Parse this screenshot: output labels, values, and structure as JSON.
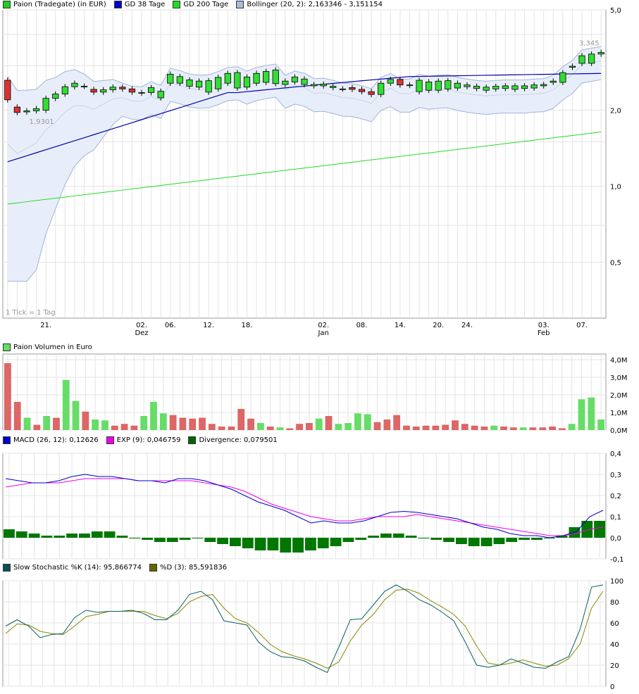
{
  "chart_data": [
    {
      "type": "candlestick",
      "title": "Paion (Tradegate) (in EUR)",
      "legend": [
        {
          "label": "Paion (Tradegate) (in EUR)",
          "color": "#22cc22"
        },
        {
          "label": "GD 38 Tage",
          "color": "#0000cc"
        },
        {
          "label": "GD 200 Tage",
          "color": "#22dd22"
        },
        {
          "label": "Bollinger (20, 2): 2,163346 - 3,151154",
          "color": "#a8bce0"
        }
      ],
      "y_scale": "log",
      "ylim": [
        0.3,
        5.0
      ],
      "y_ticks": [
        {
          "value": 5.0,
          "label": "5,0"
        },
        {
          "value": 2.0,
          "label": "2,0"
        },
        {
          "value": 1.0,
          "label": "1,0"
        },
        {
          "value": 0.5,
          "label": "0,5"
        }
      ],
      "x_ticks": [
        {
          "index": 2,
          "label": "21."
        },
        {
          "index": 7,
          "label": "02.",
          "sub": "Dez"
        },
        {
          "index": 9,
          "label": "06."
        },
        {
          "index": 11,
          "label": "12."
        },
        {
          "index": 13,
          "label": "18."
        },
        {
          "index": 17,
          "label": "02.",
          "sub": "Jan"
        },
        {
          "index": 19,
          "label": "08."
        },
        {
          "index": 21,
          "label": "14."
        },
        {
          "index": 23,
          "label": "20."
        },
        {
          "index": 25,
          "label": "24."
        },
        {
          "index": 29,
          "label": "03.",
          "sub": "Feb"
        },
        {
          "index": 31,
          "label": "07."
        }
      ],
      "annotations": [
        "1,9301",
        "3,345"
      ],
      "footnote": "1 Tick = 1 Tag",
      "open": [
        2.63,
        2.06,
        1.97,
        1.99,
        2.0,
        2.23,
        2.32,
        2.48,
        2.49,
        2.42,
        2.36,
        2.41,
        2.47,
        2.43,
        2.34,
        2.35,
        2.24,
        2.56,
        2.56,
        2.49,
        2.47,
        2.36,
        2.43,
        2.56,
        2.45,
        2.47,
        2.56,
        2.58,
        2.55,
        2.53,
        2.59,
        2.53,
        2.5,
        2.5,
        2.46,
        2.43,
        2.46,
        2.42,
        2.37,
        2.31,
        2.56,
        2.65,
        2.51,
        2.37,
        2.4,
        2.4,
        2.43,
        2.45,
        2.48,
        2.44,
        2.4,
        2.43,
        2.44,
        2.42,
        2.44,
        2.45,
        2.5,
        2.58,
        2.58,
        2.96,
        3.07,
        3.07,
        3.34
      ],
      "close": [
        2.2,
        1.96,
        1.99,
        2.03,
        2.23,
        2.32,
        2.48,
        2.56,
        2.49,
        2.36,
        2.41,
        2.47,
        2.43,
        2.36,
        2.35,
        2.46,
        2.38,
        2.78,
        2.72,
        2.64,
        2.61,
        2.62,
        2.7,
        2.8,
        2.82,
        2.71,
        2.8,
        2.85,
        2.89,
        2.61,
        2.71,
        2.66,
        2.53,
        2.54,
        2.49,
        2.43,
        2.42,
        2.37,
        2.31,
        2.56,
        2.65,
        2.52,
        2.52,
        2.63,
        2.59,
        2.61,
        2.62,
        2.56,
        2.52,
        2.49,
        2.47,
        2.49,
        2.5,
        2.5,
        2.5,
        2.52,
        2.53,
        2.61,
        2.82,
        2.99,
        3.29,
        3.34,
        3.39
      ],
      "volume_series": {
        "title": "Paion Volumen in Euro",
        "ylim": [
          0,
          4000000
        ],
        "y_ticks": [
          "0,0M",
          "1,0M",
          "2,0M",
          "3,0M",
          "4,0M"
        ],
        "values": [
          3800000,
          1600000,
          700000,
          300000,
          800000,
          700000,
          2850000,
          1650000,
          1050000,
          600000,
          550000,
          250000,
          350000,
          250000,
          800000,
          1600000,
          950000,
          850000,
          700000,
          650000,
          700000,
          350000,
          200000,
          200000,
          1200000,
          650000,
          400000,
          200000,
          150000,
          100000,
          350000,
          400000,
          650000,
          800000,
          350000,
          400000,
          950000,
          900000,
          450000,
          600000,
          850000,
          250000,
          200000,
          250000,
          250000,
          300000,
          550000,
          350000,
          250000,
          200000,
          250000,
          200000,
          150000,
          150000,
          150000,
          150000,
          200000,
          100000,
          350000,
          1750000,
          1850000,
          600000
        ],
        "up": [
          false,
          false,
          true,
          false,
          true,
          false,
          true,
          true,
          false,
          true,
          true,
          false,
          false,
          false,
          true,
          true,
          true,
          false,
          false,
          false,
          false,
          false,
          false,
          false,
          false,
          false,
          true,
          false,
          true,
          false,
          false,
          false,
          true,
          false,
          true,
          true,
          true,
          true,
          false,
          false,
          false,
          false,
          false,
          false,
          false,
          false,
          false,
          false,
          false,
          false,
          true,
          false,
          false,
          true,
          false,
          false,
          false,
          false,
          true,
          true,
          true,
          true
        ]
      }
    },
    {
      "type": "line",
      "legend": [
        {
          "label": "MACD (26, 12): 0,12626",
          "color": "#0000cc"
        },
        {
          "label": "EXP (9): 0,046759",
          "color": "#ee00ee"
        },
        {
          "label": "Divergence: 0,079501",
          "color": "#006600"
        }
      ],
      "ylim": [
        -0.1,
        0.4
      ],
      "y_ticks": [
        "0,4",
        "0,3",
        "0,2",
        "0,1",
        "0,0",
        "-0,1"
      ],
      "macd": [
        0.28,
        0.27,
        0.26,
        0.26,
        0.27,
        0.29,
        0.3,
        0.29,
        0.29,
        0.28,
        0.27,
        0.27,
        0.26,
        0.28,
        0.28,
        0.27,
        0.25,
        0.23,
        0.2,
        0.17,
        0.15,
        0.13,
        0.1,
        0.07,
        0.08,
        0.07,
        0.07,
        0.08,
        0.1,
        0.12,
        0.125,
        0.12,
        0.11,
        0.1,
        0.09,
        0.07,
        0.05,
        0.04,
        0.02,
        0.01,
        0.01,
        0.0,
        0.01,
        0.03,
        0.1,
        0.13
      ],
      "exp": [
        0.24,
        0.25,
        0.26,
        0.26,
        0.26,
        0.27,
        0.28,
        0.28,
        0.28,
        0.28,
        0.27,
        0.27,
        0.27,
        0.27,
        0.27,
        0.26,
        0.25,
        0.24,
        0.22,
        0.19,
        0.16,
        0.14,
        0.12,
        0.1,
        0.09,
        0.08,
        0.08,
        0.09,
        0.1,
        0.1,
        0.1,
        0.11,
        0.1,
        0.09,
        0.08,
        0.07,
        0.06,
        0.05,
        0.04,
        0.03,
        0.02,
        0.01,
        0.01,
        0.02,
        0.04,
        0.05
      ],
      "divergence": [
        0.04,
        0.03,
        0.02,
        0.01,
        0.01,
        0.02,
        0.02,
        0.03,
        0.03,
        0.01,
        0.0,
        -0.01,
        -0.02,
        -0.02,
        -0.01,
        0.0,
        -0.02,
        -0.03,
        -0.04,
        -0.05,
        -0.06,
        -0.06,
        -0.07,
        -0.07,
        -0.06,
        -0.05,
        -0.04,
        -0.02,
        -0.01,
        0.01,
        0.02,
        0.02,
        0.01,
        0.0,
        -0.01,
        -0.02,
        -0.03,
        -0.04,
        -0.04,
        -0.03,
        -0.02,
        -0.01,
        -0.01,
        0.0,
        0.01,
        0.05,
        0.08,
        0.08
      ]
    },
    {
      "type": "line",
      "legend": [
        {
          "label": "Slow Stochastic %K (14): 95,866774",
          "color": "#0b5050"
        },
        {
          "label": "%D (3): 85,591836",
          "color": "#666600"
        }
      ],
      "ylim": [
        0,
        100
      ],
      "y_ticks": [
        "100",
        "80",
        "60",
        "40",
        "20",
        "0"
      ],
      "k": [
        57,
        63,
        57,
        46,
        49,
        50,
        65,
        72,
        70,
        71,
        71,
        72,
        69,
        63,
        63,
        72,
        87,
        90,
        82,
        62,
        60,
        58,
        42,
        33,
        28,
        27,
        24,
        18,
        13,
        37,
        63,
        64,
        77,
        90,
        96,
        90,
        82,
        77,
        70,
        62,
        42,
        20,
        18,
        20,
        26,
        22,
        18,
        17,
        23,
        28,
        54,
        94,
        96
      ],
      "d": [
        50,
        59,
        58,
        52,
        50,
        49,
        57,
        66,
        68,
        71,
        71,
        71,
        71,
        67,
        64,
        69,
        80,
        85,
        87,
        74,
        64,
        60,
        51,
        40,
        33,
        29,
        26,
        22,
        17,
        23,
        43,
        58,
        68,
        82,
        91,
        92,
        88,
        81,
        75,
        68,
        57,
        38,
        22,
        20,
        22,
        25,
        22,
        19,
        20,
        26,
        40,
        74,
        90
      ]
    }
  ]
}
